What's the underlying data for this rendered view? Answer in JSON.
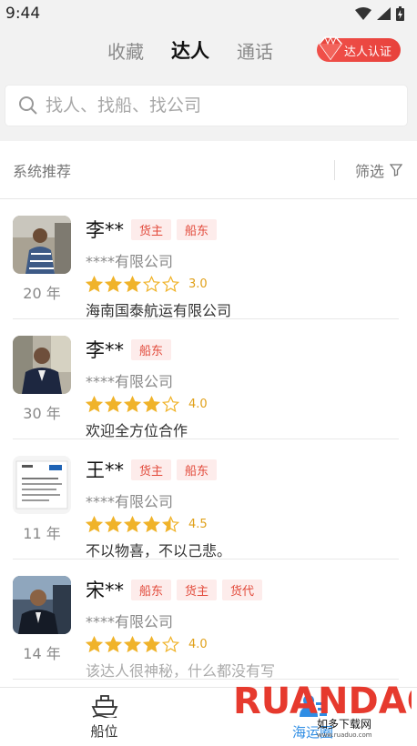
{
  "status": {
    "time": "9:44"
  },
  "tabs": [
    {
      "label": "收藏"
    },
    {
      "label": "达人"
    },
    {
      "label": "通话"
    }
  ],
  "cert_button": "达人认证",
  "search": {
    "placeholder": "找人、找船、找公司"
  },
  "filterbar": {
    "recommend": "系统推荐",
    "filter": "筛选"
  },
  "items": [
    {
      "name": "李**",
      "tags": [
        "货主",
        "船东"
      ],
      "company": "****有限公司",
      "rating": 3.0,
      "score": "3.0",
      "desc": "海南国泰航运有限公司",
      "years": "20 年"
    },
    {
      "name": "李**",
      "tags": [
        "船东"
      ],
      "company": "****有限公司",
      "rating": 4.0,
      "score": "4.0",
      "desc": "欢迎全方位合作",
      "years": "30 年"
    },
    {
      "name": "王**",
      "tags": [
        "货主",
        "船东"
      ],
      "company": "****有限公司",
      "rating": 4.5,
      "score": "4.5",
      "desc": "不以物喜，不以己悲。",
      "years": "11 年"
    },
    {
      "name": "宋**",
      "tags": [
        "船东",
        "货主",
        "货代"
      ],
      "company": "****有限公司",
      "rating": 4.0,
      "score": "4.0",
      "desc": "该达人很神秘，什么都没有写",
      "years": "14 年"
    }
  ],
  "bottomnav": [
    {
      "label": "船位"
    },
    {
      "label": "海运圈"
    }
  ],
  "watermark": {
    "brand": "RUANDAO",
    "sub": "如多下载网",
    "url": "www.ruaduo.com"
  },
  "colors": {
    "accent": "#2f8de4",
    "tag": "#e24a3b",
    "star": "#f0b32a"
  }
}
